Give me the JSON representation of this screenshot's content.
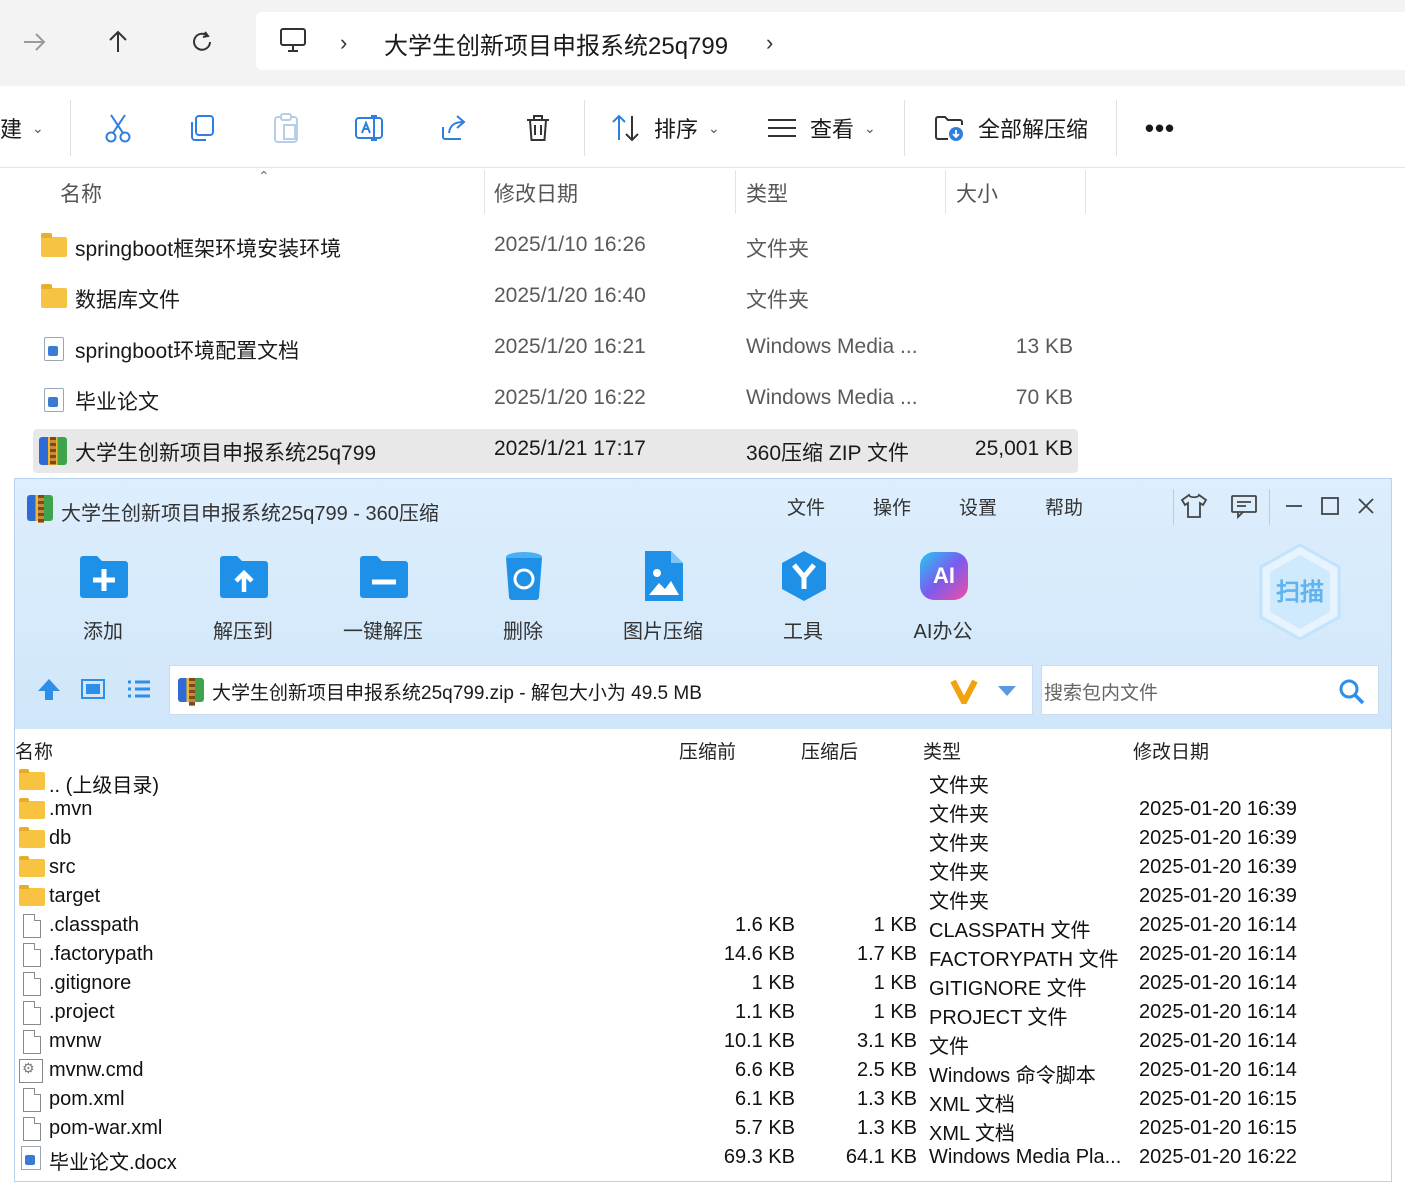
{
  "explorer": {
    "address": {
      "path": "大学生创新项目申报系统25q799"
    },
    "toolbar": {
      "new_label": "建",
      "sort_label": "排序",
      "view_label": "查看",
      "extract_all_label": "全部解压缩"
    },
    "columns": {
      "name": "名称",
      "modified": "修改日期",
      "type": "类型",
      "size": "大小"
    },
    "files": [
      {
        "icon": "folder-icon",
        "name": "springboot框架环境安装环境",
        "modified": "2025/1/10 16:26",
        "type": "文件夹",
        "size": ""
      },
      {
        "icon": "folder-icon",
        "name": "数据库文件",
        "modified": "2025/1/20 16:40",
        "type": "文件夹",
        "size": ""
      },
      {
        "icon": "media-doc-icon",
        "name": "springboot环境配置文档",
        "modified": "2025/1/20 16:21",
        "type": "Windows Media ...",
        "size": "13 KB"
      },
      {
        "icon": "media-doc-icon",
        "name": "毕业论文",
        "modified": "2025/1/20 16:22",
        "type": "Windows Media ...",
        "size": "70 KB"
      },
      {
        "icon": "zip-archive-icon",
        "name": "大学生创新项目申报系统25q799",
        "modified": "2025/1/21 17:17",
        "type": "360压缩 ZIP 文件",
        "size": "25,001 KB",
        "selected": true
      }
    ]
  },
  "zipwin": {
    "title": "大学生创新项目申报系统25q799 - 360压缩",
    "menu": [
      "文件",
      "操作",
      "设置",
      "帮助"
    ],
    "actions": [
      "添加",
      "解压到",
      "一键解压",
      "删除",
      "图片压缩",
      "工具",
      "AI办公"
    ],
    "scan_label": "扫描",
    "ai_badge": "AI",
    "path_text": "大学生创新项目申报系统25q799.zip - 解包大小为 49.5 MB",
    "search_placeholder": "搜索包内文件",
    "columns": {
      "name": "名称",
      "before": "压缩前",
      "after": "压缩后",
      "type": "类型",
      "modified": "修改日期"
    },
    "entries": [
      {
        "icon": "folder-icon",
        "name": ".. (上级目录)",
        "before": "",
        "after": "",
        "type": "文件夹",
        "modified": ""
      },
      {
        "icon": "folder-icon",
        "name": ".mvn",
        "before": "",
        "after": "",
        "type": "文件夹",
        "modified": "2025-01-20 16:39"
      },
      {
        "icon": "folder-icon",
        "name": "db",
        "before": "",
        "after": "",
        "type": "文件夹",
        "modified": "2025-01-20 16:39"
      },
      {
        "icon": "folder-icon",
        "name": "src",
        "before": "",
        "after": "",
        "type": "文件夹",
        "modified": "2025-01-20 16:39"
      },
      {
        "icon": "folder-icon",
        "name": "target",
        "before": "",
        "after": "",
        "type": "文件夹",
        "modified": "2025-01-20 16:39"
      },
      {
        "icon": "file-icon",
        "name": ".classpath",
        "before": "1.6 KB",
        "after": "1 KB",
        "type": "CLASSPATH 文件",
        "modified": "2025-01-20 16:14"
      },
      {
        "icon": "file-icon",
        "name": ".factorypath",
        "before": "14.6 KB",
        "after": "1.7 KB",
        "type": "FACTORYPATH 文件",
        "modified": "2025-01-20 16:14"
      },
      {
        "icon": "file-icon",
        "name": ".gitignore",
        "before": "1 KB",
        "after": "1 KB",
        "type": "GITIGNORE 文件",
        "modified": "2025-01-20 16:14"
      },
      {
        "icon": "file-icon",
        "name": ".project",
        "before": "1.1 KB",
        "after": "1 KB",
        "type": "PROJECT 文件",
        "modified": "2025-01-20 16:14"
      },
      {
        "icon": "file-icon",
        "name": "mvnw",
        "before": "10.1 KB",
        "after": "3.1 KB",
        "type": "文件",
        "modified": "2025-01-20 16:14"
      },
      {
        "icon": "cmd-script-icon",
        "name": "mvnw.cmd",
        "before": "6.6 KB",
        "after": "2.5 KB",
        "type": "Windows 命令脚本",
        "modified": "2025-01-20 16:14"
      },
      {
        "icon": "file-icon",
        "name": "pom.xml",
        "before": "6.1 KB",
        "after": "1.3 KB",
        "type": "XML 文档",
        "modified": "2025-01-20 16:15"
      },
      {
        "icon": "file-icon",
        "name": "pom-war.xml",
        "before": "5.7 KB",
        "after": "1.3 KB",
        "type": "XML 文档",
        "modified": "2025-01-20 16:15"
      },
      {
        "icon": "media-doc-icon",
        "name": "毕业论文.docx",
        "before": "69.3 KB",
        "after": "64.1 KB",
        "type": "Windows Media Pla...",
        "modified": "2025-01-20 16:22"
      }
    ]
  },
  "colors": {
    "accent": "#2f7fe0",
    "selected_row": "#e8e8e8",
    "zip_header": "#d6eafb"
  }
}
